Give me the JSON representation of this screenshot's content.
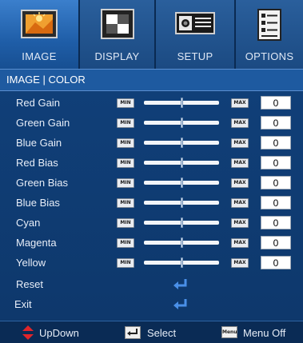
{
  "tabs": [
    {
      "label": "IMAGE",
      "icon": "image-icon",
      "active": true
    },
    {
      "label": "DISPLAY",
      "icon": "display-icon",
      "active": false
    },
    {
      "label": "SETUP",
      "icon": "projector-icon",
      "active": false
    },
    {
      "label": "OPTIONS",
      "icon": "options-icon",
      "active": false
    }
  ],
  "section_title": "IMAGE | COLOR",
  "slider_min_label": "MIN",
  "slider_max_label": "MAX",
  "settings": [
    {
      "name": "Red Gain",
      "value": "0",
      "position": 0.5
    },
    {
      "name": "Green Gain",
      "value": "0",
      "position": 0.5
    },
    {
      "name": "Blue Gain",
      "value": "0",
      "position": 0.5
    },
    {
      "name": "Red Bias",
      "value": "0",
      "position": 0.5
    },
    {
      "name": "Green Bias",
      "value": "0",
      "position": 0.5
    },
    {
      "name": "Blue Bias",
      "value": "0",
      "position": 0.5
    },
    {
      "name": "Cyan",
      "value": "0",
      "position": 0.5
    },
    {
      "name": "Magenta",
      "value": "0",
      "position": 0.5
    },
    {
      "name": "Yellow",
      "value": "0",
      "position": 0.5
    }
  ],
  "actions": [
    {
      "name": "Reset",
      "icon": "enter-icon"
    },
    {
      "name": "Exit",
      "icon": "enter-icon"
    }
  ],
  "footer": {
    "updown": "UpDown",
    "select": "Select",
    "menu_key": "Menu",
    "menu_off": "Menu Off"
  },
  "colors": {
    "background": "#0c3566",
    "active_tab": "#2f74c4",
    "header_bar": "#1e5aa0",
    "footer_arrow": "#e0252a"
  }
}
